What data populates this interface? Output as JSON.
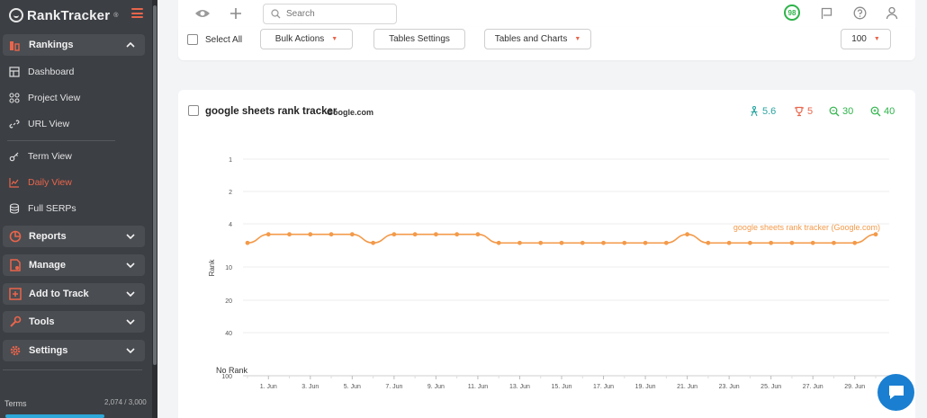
{
  "sidebar": {
    "logo_text": "RankTracker",
    "logo_sup": "®",
    "groups": {
      "rankings": "Rankings",
      "reports": "Reports",
      "manage": "Manage",
      "add_to_track": "Add to Track",
      "tools": "Tools",
      "settings": "Settings"
    },
    "items": {
      "dashboard": "Dashboard",
      "project_view": "Project View",
      "url_view": "URL View",
      "term_view": "Term View",
      "daily_view": "Daily View",
      "full_serps": "Full SERPs"
    },
    "terms": "Terms",
    "quota": "2,074 / 3,000"
  },
  "topbar": {
    "search_placeholder": "Search",
    "score": "98"
  },
  "toolbar": {
    "select_all": "Select All",
    "bulk_actions": "Bulk Actions",
    "tables_settings": "Tables Settings",
    "tables_and_charts": "Tables and Charts",
    "page_size": "100"
  },
  "card": {
    "keyword": "google sheets rank tracker",
    "engine": "Google.com",
    "stats": {
      "avg": "5.6",
      "best": "5",
      "s1": "30",
      "s2": "40"
    }
  },
  "colors": {
    "accent": "#e9654b",
    "series": "#f39a4a",
    "green": "#2eb34a",
    "teal": "#2aa5a0"
  },
  "chart_data": {
    "type": "line",
    "xlabel": "",
    "ylabel": "Rank",
    "y_ticks": [
      "1",
      "2",
      "4",
      "10",
      "20",
      "40",
      "100"
    ],
    "y_ticks_bottom_label": "No Rank",
    "x_tick_labels": [
      "1. Jun",
      "3. Jun",
      "5. Jun",
      "7. Jun",
      "9. Jun",
      "11. Jun",
      "13. Jun",
      "15. Jun",
      "17. Jun",
      "19. Jun",
      "21. Jun",
      "23. Jun",
      "25. Jun",
      "27. Jun",
      "29. Jun"
    ],
    "series": [
      {
        "name": "google sheets rank tracker (Google.com)",
        "x": [
          "31. May",
          "1. Jun",
          "2. Jun",
          "3. Jun",
          "4. Jun",
          "5. Jun",
          "6. Jun",
          "7. Jun",
          "8. Jun",
          "9. Jun",
          "10. Jun",
          "11. Jun",
          "12. Jun",
          "13. Jun",
          "14. Jun",
          "15. Jun",
          "16. Jun",
          "17. Jun",
          "18. Jun",
          "19. Jun",
          "20. Jun",
          "21. Jun",
          "22. Jun",
          "23. Jun",
          "24. Jun",
          "25. Jun",
          "26. Jun",
          "27. Jun",
          "28. Jun",
          "29. Jun",
          "30. Jun"
        ],
        "values": [
          6,
          5,
          5,
          5,
          5,
          5,
          6,
          5,
          5,
          5,
          5,
          5,
          6,
          6,
          6,
          6,
          6,
          6,
          6,
          6,
          6,
          5,
          6,
          6,
          6,
          6,
          6,
          6,
          6,
          6,
          5
        ]
      }
    ],
    "grid": true,
    "legend": "inline-right"
  }
}
